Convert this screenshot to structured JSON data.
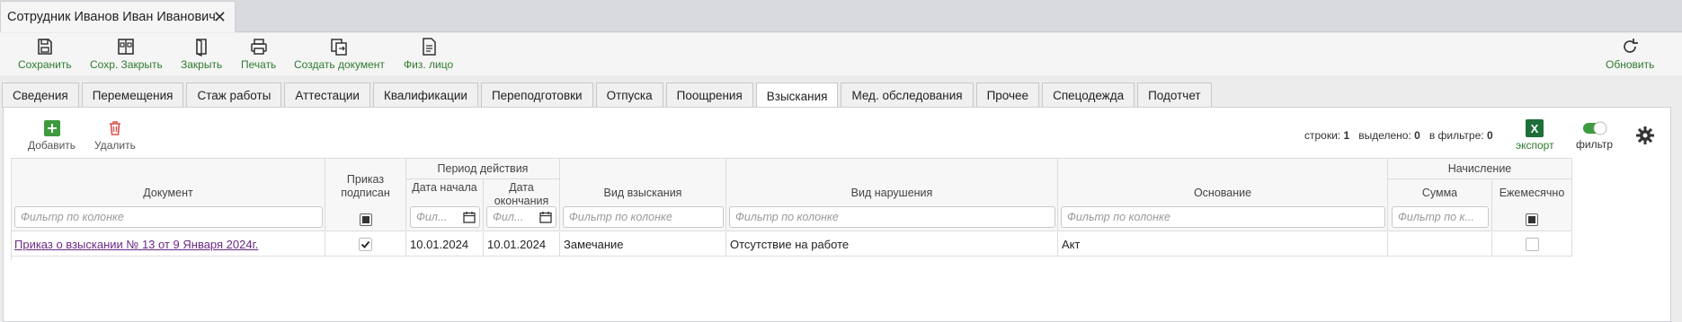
{
  "window": {
    "tab_title": "Сотрудник Иванов Иван Иванович",
    "close_glyph": "✕"
  },
  "toolbar": {
    "save": "Сохранить",
    "save_close": "Сохр. Закрыть",
    "close": "Закрыть",
    "print": "Печать",
    "create_doc": "Создать документ",
    "person": "Физ. лицо",
    "refresh": "Обновить"
  },
  "tabs": [
    "Сведения",
    "Перемещения",
    "Стаж работы",
    "Аттестации",
    "Квалификации",
    "Переподготовки",
    "Отпуска",
    "Поощрения",
    "Взыскания",
    "Мед. обследования",
    "Прочее",
    "Спецодежда",
    "Подотчет"
  ],
  "active_tab": "Взыскания",
  "subtoolbar": {
    "add": "Добавить",
    "delete": "Удалить",
    "export": "экспорт",
    "filter": "фильтр"
  },
  "stats": {
    "rows_label": "строки:",
    "rows": "1",
    "selected_label": "выделено:",
    "selected": "0",
    "in_filter_label": "в фильтре:",
    "in_filter": "0"
  },
  "grid": {
    "headers": {
      "document": "Документ",
      "order_signed": "Приказ подписан",
      "period": "Период действия",
      "start_date": "Дата начала",
      "end_date": "Дата окончания",
      "penalty_type": "Вид взыскания",
      "violation_type": "Вид нарушения",
      "basis": "Основание",
      "accrual": "Начисление",
      "amount": "Сумма",
      "monthly": "Ежемесячно"
    },
    "filters": {
      "document": "Фильтр по колонке",
      "start_date": "Фил...",
      "end_date": "Фил...",
      "penalty_type": "Фильтр по колонке",
      "violation_type": "Фильтр по колонке",
      "basis": "Фильтр по колонке",
      "amount": "Фильтр по к..."
    },
    "rows": [
      {
        "document": "Приказ о взыскании № 13 от 9 Января 2024г.",
        "order_signed": true,
        "start_date": "10.01.2024",
        "end_date": "10.01.2024",
        "penalty_type": "Замечание",
        "violation_type": "Отсутствие на работе",
        "basis": "Акт",
        "amount": "",
        "monthly": false
      }
    ]
  },
  "colors": {
    "accent_green": "#2f7a2f",
    "delete_red": "#d9534f",
    "link_purple": "#6a2a86"
  }
}
